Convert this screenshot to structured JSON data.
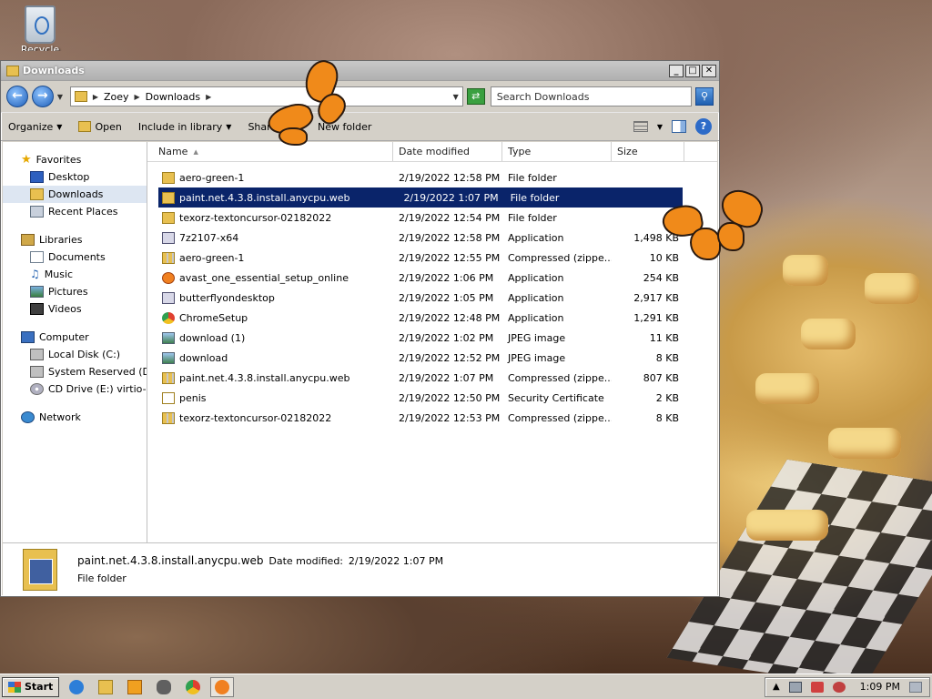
{
  "desktop": {
    "recycle_bin_label": "Recycle Bin"
  },
  "window": {
    "title": "Downloads",
    "controls": {
      "minimize": "_",
      "maximize": "□",
      "close": "✕"
    }
  },
  "address": {
    "crumbs": [
      "Zoey",
      "Downloads"
    ],
    "search_placeholder": "Search Downloads"
  },
  "toolbar": {
    "organize": "Organize",
    "open": "Open",
    "include_in_library": "Include in library",
    "share_with": "Share with",
    "new_folder": "New folder",
    "help": "?"
  },
  "nav": {
    "favorites": {
      "label": "Favorites",
      "items": [
        "Desktop",
        "Downloads",
        "Recent Places"
      ]
    },
    "libraries": {
      "label": "Libraries",
      "items": [
        "Documents",
        "Music",
        "Pictures",
        "Videos"
      ]
    },
    "computer": {
      "label": "Computer",
      "items": [
        "Local Disk (C:)",
        "System Reserved (D:)",
        "CD Drive (E:) virtio-win"
      ]
    },
    "network": {
      "label": "Network"
    }
  },
  "columns": {
    "name": "Name",
    "date": "Date modified",
    "type": "Type",
    "size": "Size"
  },
  "files": [
    {
      "name": "aero-green-1",
      "date": "2/19/2022 12:58 PM",
      "type": "File folder",
      "size": "",
      "icon": "folder-icon"
    },
    {
      "name": "paint.net.4.3.8.install.anycpu.web",
      "date": "2/19/2022 1:07 PM",
      "type": "File folder",
      "size": "",
      "icon": "folder-icon",
      "selected": true
    },
    {
      "name": "texorz-textoncursor-02182022",
      "date": "2/19/2022 12:54 PM",
      "type": "File folder",
      "size": "",
      "icon": "folder-icon"
    },
    {
      "name": "7z2107-x64",
      "date": "2/19/2022 12:58 PM",
      "type": "Application",
      "size": "1,498 KB",
      "icon": "app-icon"
    },
    {
      "name": "aero-green-1",
      "date": "2/19/2022 12:55 PM",
      "type": "Compressed (zippe...",
      "size": "10 KB",
      "icon": "zip-icon"
    },
    {
      "name": "avast_one_essential_setup_online",
      "date": "2/19/2022 1:06 PM",
      "type": "Application",
      "size": "254 KB",
      "icon": "avast-icon"
    },
    {
      "name": "butterflyondesktop",
      "date": "2/19/2022 1:05 PM",
      "type": "Application",
      "size": "2,917 KB",
      "icon": "app-icon"
    },
    {
      "name": "ChromeSetup",
      "date": "2/19/2022 12:48 PM",
      "type": "Application",
      "size": "1,291 KB",
      "icon": "chrome-icon"
    },
    {
      "name": "download (1)",
      "date": "2/19/2022 1:02 PM",
      "type": "JPEG image",
      "size": "11 KB",
      "icon": "jpeg-icon"
    },
    {
      "name": "download",
      "date": "2/19/2022 12:52 PM",
      "type": "JPEG image",
      "size": "8 KB",
      "icon": "jpeg-icon"
    },
    {
      "name": "paint.net.4.3.8.install.anycpu.web",
      "date": "2/19/2022 1:07 PM",
      "type": "Compressed (zippe...",
      "size": "807 KB",
      "icon": "zip-icon"
    },
    {
      "name": "penis",
      "date": "2/19/2022 12:50 PM",
      "type": "Security Certificate",
      "size": "2 KB",
      "icon": "certificate-icon"
    },
    {
      "name": "texorz-textoncursor-02182022",
      "date": "2/19/2022 12:53 PM",
      "type": "Compressed (zippe...",
      "size": "8 KB",
      "icon": "zip-icon"
    }
  ],
  "details": {
    "name": "paint.net.4.3.8.install.anycpu.web",
    "modified_label": "Date modified:",
    "modified_value": "2/19/2022 1:07 PM",
    "type": "File folder"
  },
  "taskbar": {
    "start": "Start",
    "pinned": [
      "internet-explorer-icon",
      "explorer-icon",
      "media-player-icon",
      "raccoon-icon",
      "chrome-icon",
      "avast-icon"
    ],
    "clock": "1:09 PM"
  },
  "colors": {
    "selection": "#0a246a",
    "butterfly": "#f08a1a"
  }
}
